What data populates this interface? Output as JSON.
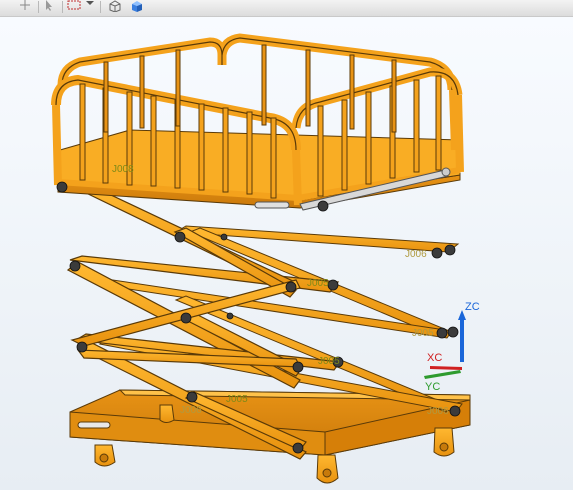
{
  "toolbar": {
    "icons": [
      "move-icon",
      "pointer-icon",
      "select-box-icon",
      "dropdown-icon",
      "wireframe-cube-icon",
      "shaded-cube-icon"
    ]
  },
  "model": {
    "color": "#f4a21c",
    "edge_color": "#5a3a08",
    "joint_labels": [
      "J008",
      "J006",
      "J005",
      "J005",
      "J005",
      "J006",
      "J005",
      "J006"
    ]
  },
  "triad": {
    "zc": "ZC",
    "xc": "XC",
    "yc": "YC",
    "zc_color": "#1a66d9",
    "xc_color": "#d02020",
    "yc_color": "#2e9b2e"
  }
}
